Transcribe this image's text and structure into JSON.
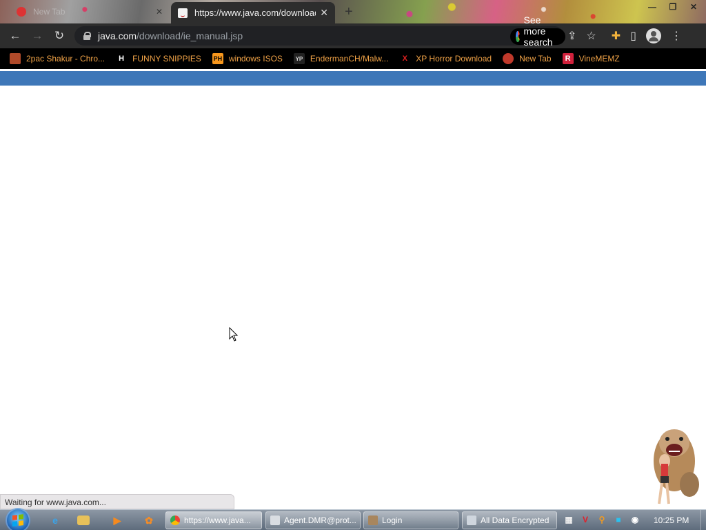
{
  "tabs": {
    "inactive_title": "New Tab",
    "active_title": "https://www.java.com/download"
  },
  "toolbar": {
    "url_host": "java.com",
    "url_path": "/download/ie_manual.jsp",
    "search_pill_label": "See more search results"
  },
  "bookmarks": [
    {
      "label": "2pac Shakur - Chro...",
      "icon": "paper-bag-icon",
      "icon_glyph": "",
      "icon_color": "#b04a2a"
    },
    {
      "label": "FUNNY SNIPPIES",
      "icon": "h-logo-icon",
      "icon_glyph": "H",
      "icon_color": "#ffffff"
    },
    {
      "label": "windows ISOS",
      "icon": "ph-logo-icon",
      "icon_glyph": "PH",
      "icon_color": "#f7971d"
    },
    {
      "label": "EndermanCH/Malw...",
      "icon": "yp-logo-icon",
      "icon_glyph": "YP",
      "icon_color": "#333333"
    },
    {
      "label": "XP Horror Download",
      "icon": "x-logo-icon",
      "icon_glyph": "X",
      "icon_color": "#e02020"
    },
    {
      "label": "New Tab",
      "icon": "skull-icon",
      "icon_glyph": "",
      "icon_color": "#c0392b"
    },
    {
      "label": "VineMEMZ",
      "icon": "r-logo-icon",
      "icon_glyph": "R",
      "icon_color": "#d1213c"
    }
  ],
  "status_text": "Waiting for www.java.com...",
  "taskbar": {
    "tasks": [
      {
        "label": "https://www.java...",
        "icon": "chrome-icon"
      },
      {
        "label": "Agent.DMR@prot...",
        "icon": "app-window-icon"
      },
      {
        "label": "Login",
        "icon": "login-app-icon"
      },
      {
        "label": "All Data Encrypted",
        "icon": "encrypted-window-icon"
      }
    ],
    "clock": "10:25 PM"
  },
  "colors": {
    "page_bar": "#3e77b8",
    "bookmark_text": "#f1a347"
  }
}
